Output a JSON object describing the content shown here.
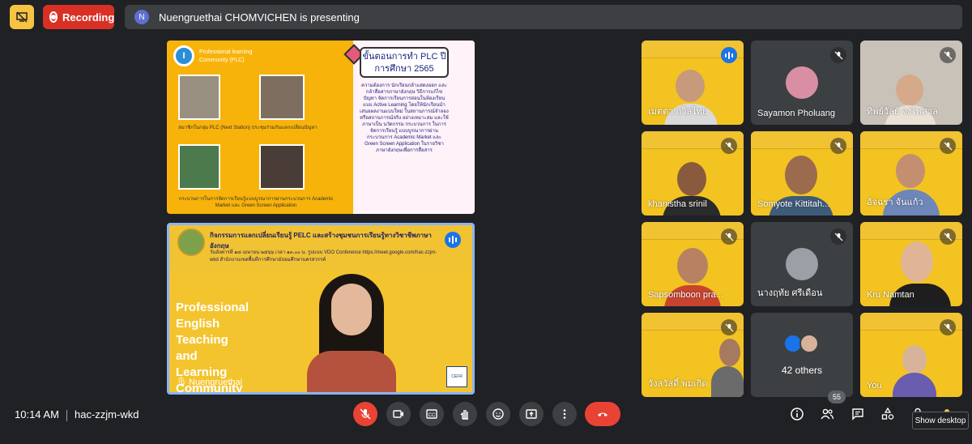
{
  "topbar": {
    "recording_label": "Recording",
    "presenter_initial": "N",
    "presenting_text": "Nuengruethai CHOMVICHEN is presenting"
  },
  "slide": {
    "badge": "I",
    "heading": "Professional learning Community (PLC)",
    "caption_top": "สมาชิกในกลุ่ม PLC (Next Station) ประชุมร่วมกันแลกเปลี่ยนปัญหา",
    "caption_bottom": "กระบวนการในการจัดการเรียนรู้แบบบูรณาการผ่านกระบวนการ Academic Market และ Green Screen Application",
    "plc_title": "ขั้นตอนการทำ PLC ปีการศึกษา 2565",
    "plc_body": "ความต้องการ นักเรียนกล้าแสดงออก และกล้าสื่อสารภาษาอังกฤษ วิธีการแก้ไขปัญหา จัดการเรียนการสอนในห้องเรียน แบบ Active Learning โดยให้นักเรียนนำเสนอผลงานแบบใหม่ ในสถานการณ์จำลองหรือสถานการณ์จริง อย่างเหมาะสม และใช้ภาษาเป็น นวัตกรรม กระบวนการ ในการจัดการเรียนรู้ แบบบูรณาการผ่านกระบวนการ Academic Market และ Green Screen Application ในรายวิชาภาษาอังกฤษเพื่อการสื่อสาร"
  },
  "main_video": {
    "title": "กิจกรรมการแลกเปลี่ยนเรียนรู้ PELC และสร้างชุมชนการเรียนรู้ทางวิชาชีพภาษาอังกฤษ",
    "subtitle": "วันอังคารที่ ๑๘ เมษายน ๒๕๖๖ เวลา ๑๓.๐๐ น. รูปแบบ VDO Conference https://meet.google.com/hac-zzjm-wkd สำนักงานเขตพื้นที่การศึกษามัธยมศึกษานครสวรรค์",
    "text_lines": [
      "Professional",
      "English",
      "Teaching",
      "and",
      "Learning",
      "Community"
    ],
    "cefr": "CEFR",
    "name": "Nuengruethai"
  },
  "tiles": [
    {
      "name": "เมตตา ถวิลไทย",
      "state": "speaking"
    },
    {
      "name": "Sayamon Pholuang",
      "state": "muted"
    },
    {
      "name": "ทิพย์วัลย์ จงไพศาล",
      "state": "muted"
    },
    {
      "name": "khanistha srinil",
      "state": "muted"
    },
    {
      "name": "Somyote Kittitah...",
      "state": "muted"
    },
    {
      "name": "อัจฉรา จันแก้ว",
      "state": "muted"
    },
    {
      "name": "Sapsomboon pra...",
      "state": "muted"
    },
    {
      "name": "นางฤทัย ศรีเดือน",
      "state": "muted"
    },
    {
      "name": "Kru Namtan",
      "state": "muted"
    },
    {
      "name": "วังสวัสดิ์ พมเกิด",
      "state": "muted"
    },
    {
      "name": "42 others",
      "state": "none"
    },
    {
      "name": "You",
      "state": "muted"
    }
  ],
  "bottom": {
    "time": "10:14 AM",
    "meeting_code": "hac-zzjm-wkd",
    "participants_count": "55",
    "tooltip": "Show desktop"
  },
  "colors": {
    "accent_blue": "#1a73e8",
    "red": "#ea4335",
    "yellow": "#f3c321",
    "background": "#202124"
  }
}
